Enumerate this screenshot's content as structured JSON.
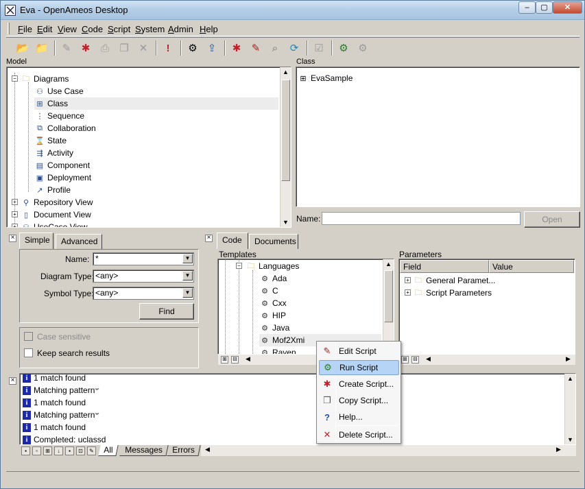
{
  "window": {
    "title": "Eva - OpenAmeos Desktop",
    "min": "–",
    "max": "▢",
    "close": "✕"
  },
  "menu": [
    {
      "prefix": "",
      "u": "F",
      "rest": "ile"
    },
    {
      "prefix": "",
      "u": "E",
      "rest": "dit"
    },
    {
      "prefix": "",
      "u": "V",
      "rest": "iew"
    },
    {
      "prefix": "",
      "u": "C",
      "rest": "ode"
    },
    {
      "prefix": "",
      "u": "S",
      "rest": "cript"
    },
    {
      "prefix": "",
      "u": "S",
      "rest": "ystem"
    },
    {
      "prefix": "",
      "u": "A",
      "rest": "dmin"
    },
    {
      "prefix": "",
      "u": "H",
      "rest": "elp"
    }
  ],
  "model_panel": {
    "label": "Model",
    "tree": [
      {
        "label": "Diagrams",
        "icon": "folder-icon"
      },
      {
        "label": "Use Case",
        "icon": "use-case-diagram-icon"
      },
      {
        "label": "Class",
        "icon": "class-diagram-icon"
      },
      {
        "label": "Sequence",
        "icon": "sequence-diagram-icon"
      },
      {
        "label": "Collaboration",
        "icon": "collaboration-diagram-icon"
      },
      {
        "label": "State",
        "icon": "state-diagram-icon"
      },
      {
        "label": "Activity",
        "icon": "activity-diagram-icon"
      },
      {
        "label": "Component",
        "icon": "component-diagram-icon"
      },
      {
        "label": "Deployment",
        "icon": "deployment-diagram-icon"
      },
      {
        "label": "Profile",
        "icon": "profile-diagram-icon"
      },
      {
        "label": "Repository View",
        "icon": "repository-view-icon"
      },
      {
        "label": "Document View",
        "icon": "document-view-icon"
      },
      {
        "label": "UseCase View",
        "icon": "usecase-view-icon"
      }
    ]
  },
  "class_panel": {
    "label": "Class",
    "items": [
      {
        "label": "EvaSample",
        "icon": "class-diagram-icon"
      }
    ],
    "name_label": "Name:",
    "name_value": "",
    "open_button": "Open"
  },
  "search_panel": {
    "tabs": [
      "Simple",
      "Advanced"
    ],
    "name_label": "Name:",
    "name_value": "*",
    "diagram_type_label": "Diagram Type:",
    "diagram_type_value": "<any>",
    "symbol_type_label": "Symbol Type:",
    "symbol_type_value": "<any>",
    "find_button": "Find",
    "case_sensitive": "Case sensitive",
    "keep_results": "Keep search results"
  },
  "code_panel": {
    "tabs": [
      "Code",
      "Documents"
    ],
    "templates_label": "Templates",
    "templates": [
      "Languages",
      "Ada",
      "C",
      "Cxx",
      "HIP",
      "Java",
      "Mof2Xmi",
      "Raven"
    ],
    "parameters_label": "Parameters",
    "columns": [
      "Field",
      "Value"
    ],
    "parameters": [
      "General Paramet...",
      "Script Parameters"
    ]
  },
  "context_menu": {
    "items": [
      {
        "label": "Edit Script",
        "icon": "edit-script-icon"
      },
      {
        "label": "Run Script",
        "icon": "run-script-icon"
      },
      {
        "label": "Create Script...",
        "icon": "create-script-icon"
      },
      {
        "label": "Copy Script...",
        "icon": "copy-script-icon"
      },
      {
        "label": "Help...",
        "icon": "help-icon"
      },
      {
        "label": "Delete Script...",
        "icon": "delete-script-icon"
      }
    ]
  },
  "log": {
    "rows": [
      {
        "text": "1 match found",
        "sup": ""
      },
      {
        "text": "Matching pattern ",
        "sup": "'*'"
      },
      {
        "text": "1 match found",
        "sup": ""
      },
      {
        "text": "Matching pattern ",
        "sup": "'*'"
      },
      {
        "text": "1 match found",
        "sup": ""
      },
      {
        "text": "Completed: uclassd",
        "sup": ""
      }
    ],
    "tabs": [
      "All",
      "Messages",
      "Errors"
    ]
  }
}
